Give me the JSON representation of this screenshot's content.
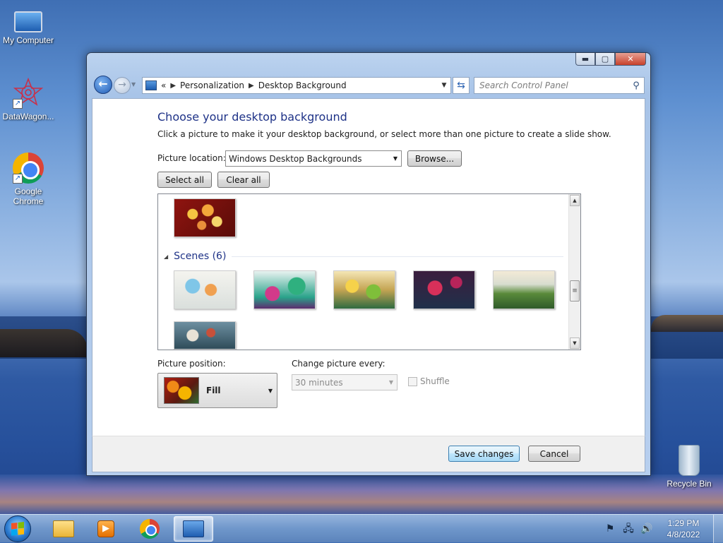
{
  "desktop": {
    "icons": [
      {
        "label": "My Computer"
      },
      {
        "label": "DataWagon..."
      },
      {
        "label": "Google\nChrome"
      },
      {
        "label": "Recycle Bin"
      }
    ]
  },
  "window": {
    "caption_buttons": {
      "minimize": "▬",
      "maximize": "▢",
      "close": "✕"
    },
    "navigation": {
      "back": "←",
      "forward": "→",
      "breadcrumb_prefix": "«",
      "breadcrumb": [
        "Personalization",
        "Desktop Background"
      ],
      "breadcrumb_sep": "▶",
      "search_placeholder": "Search Control Panel"
    },
    "main": {
      "title": "Choose your desktop background",
      "subtitle": "Click a picture to make it your desktop background, or select more than one picture to create a slide show.",
      "picture_location_label": "Picture location:",
      "picture_location_value": "Windows Desktop Backgrounds",
      "browse_label": "Browse...",
      "select_all_label": "Select all",
      "clear_all_label": "Clear all",
      "gallery": {
        "group_header": "Scenes (6)",
        "thumbnails": [
          "scene-1",
          "scene-2",
          "scene-3",
          "scene-4",
          "scene-5",
          "scene-6"
        ]
      },
      "picture_position_label": "Picture position:",
      "picture_position_value": "Fill",
      "change_every_label": "Change picture every:",
      "change_every_value": "30 minutes",
      "shuffle_label": "Shuffle"
    },
    "footer": {
      "save_label": "Save changes",
      "cancel_label": "Cancel"
    }
  },
  "taskbar": {
    "clock_time": "1:29 PM",
    "clock_date": "4/8/2022"
  },
  "colors": {
    "title_blue": "#1e3287",
    "default_button_border": "#3c7fb1"
  }
}
